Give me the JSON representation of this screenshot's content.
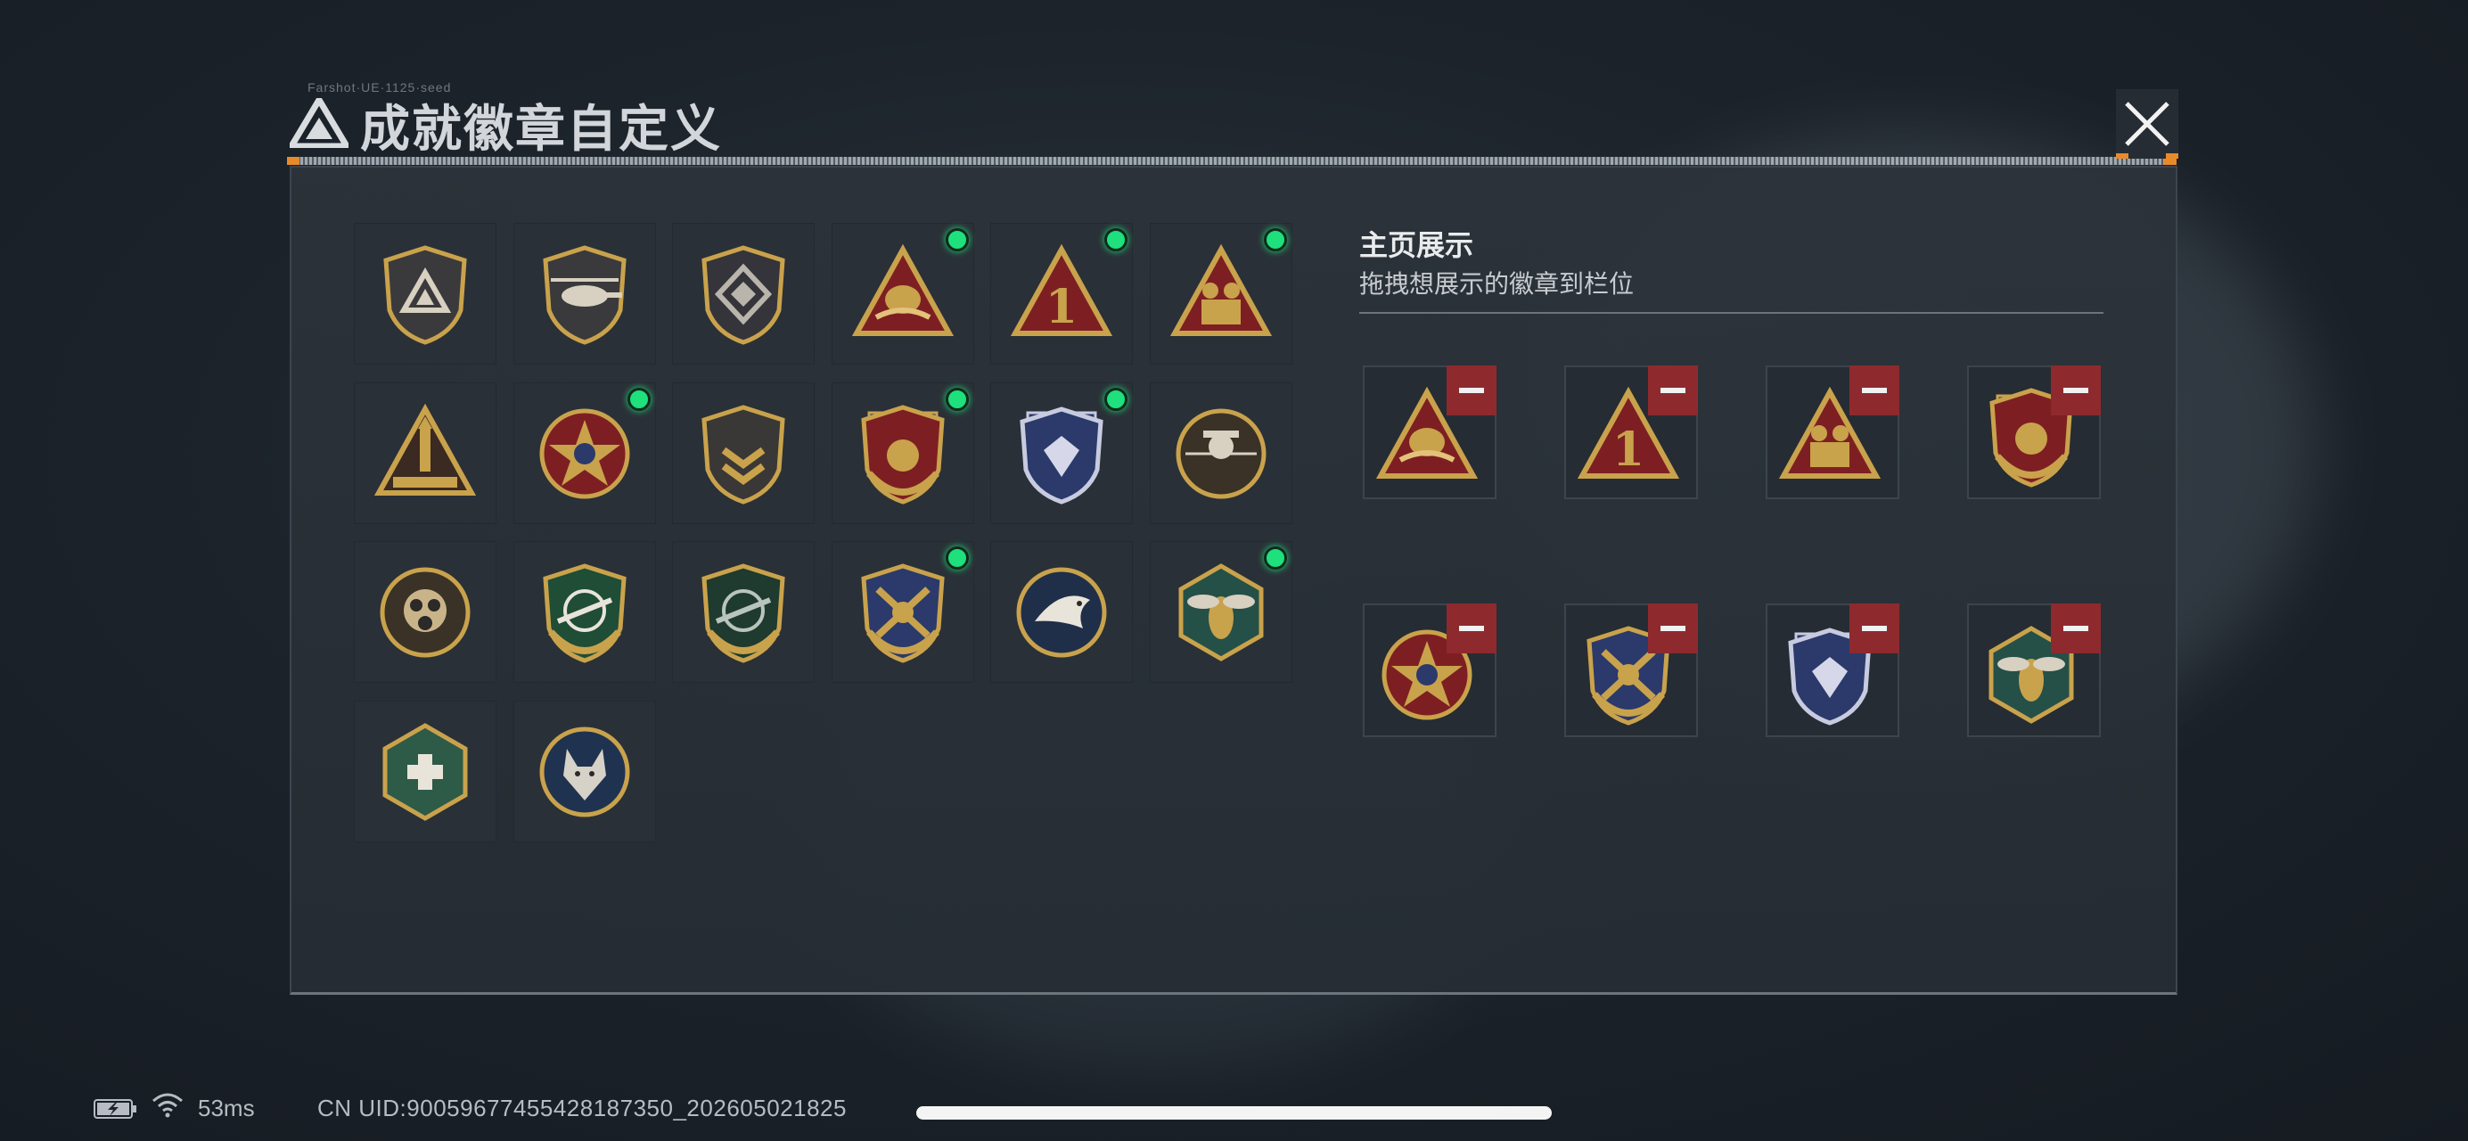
{
  "dialog": {
    "title": "成就徽章自定义",
    "title_tiny": "Farshot·UE·1125·seed"
  },
  "showcase": {
    "title": "主页展示",
    "hint": "拖拽想展示的徽章到栏位"
  },
  "badge_grid": [
    {
      "icon": "triangle-shield-badge-icon",
      "new": false
    },
    {
      "icon": "helicopter-badge-icon",
      "new": false
    },
    {
      "icon": "diamond-emblem-badge-icon",
      "new": false
    },
    {
      "icon": "golden-egg-triangle-badge-icon",
      "new": true
    },
    {
      "icon": "number-one-triangle-badge-icon",
      "new": true
    },
    {
      "icon": "soldiers-triangle-badge-icon",
      "new": true
    },
    {
      "icon": "rocket-triangle-badge-icon",
      "new": false
    },
    {
      "icon": "star-medal-badge-icon",
      "new": true
    },
    {
      "icon": "chevron-shield-badge-icon",
      "new": false
    },
    {
      "icon": "red-crest-badge-icon",
      "new": true
    },
    {
      "icon": "blue-gem-shield-badge-icon",
      "new": true
    },
    {
      "icon": "skull-target-badge-icon",
      "new": false
    },
    {
      "icon": "gas-mask-badge-icon",
      "new": false
    },
    {
      "icon": "rifle-crosshair-green-badge-icon",
      "new": false
    },
    {
      "icon": "rifle-crosshair-dark-badge-icon",
      "new": false
    },
    {
      "icon": "crossed-blades-crest-badge-icon",
      "new": true
    },
    {
      "icon": "eagle-badge-icon",
      "new": false
    },
    {
      "icon": "hornet-hexagon-badge-icon",
      "new": true
    },
    {
      "icon": "medic-hexagon-badge-icon",
      "new": false
    },
    {
      "icon": "wolf-badge-icon",
      "new": false
    }
  ],
  "showcase_slots": [
    {
      "icon": "golden-egg-triangle-badge-icon"
    },
    {
      "icon": "number-one-triangle-badge-icon"
    },
    {
      "icon": "soldiers-triangle-badge-icon"
    },
    {
      "icon": "red-crest-badge-icon"
    },
    {
      "icon": "star-medal-badge-icon"
    },
    {
      "icon": "crossed-blades-crest-badge-icon"
    },
    {
      "icon": "blue-gem-shield-badge-icon"
    },
    {
      "icon": "hornet-hexagon-badge-icon"
    }
  ],
  "status_bar": {
    "ping": "53ms",
    "uid": "CN UID:9005967745542818735​0_202605021825"
  },
  "colors": {
    "new_indicator": "#1ee07c",
    "remove_button": "#8e2a2e",
    "accent_orange": "#e88a2a",
    "badge_gold": "#c9a24c"
  }
}
